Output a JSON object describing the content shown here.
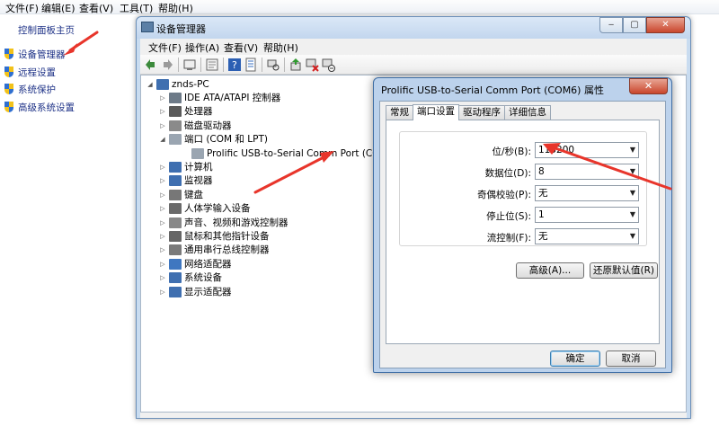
{
  "background_window": {
    "menu": [
      "文件(F)",
      "编辑(E)",
      "查看(V)",
      "工具(T)",
      "帮助(H)"
    ],
    "left_pane": {
      "home_link": "控制面板主页",
      "links": [
        "设备管理器",
        "远程设置",
        "系统保护",
        "高级系统设置"
      ]
    }
  },
  "device_manager": {
    "title": "设备管理器",
    "menu": [
      "文件(F)",
      "操作(A)",
      "查看(V)",
      "帮助(H)"
    ],
    "caption_buttons": {
      "minimize": "‒",
      "maximize": "▢",
      "close": "✕"
    },
    "toolbar_icons": [
      "back-arrow-icon",
      "forward-arrow-icon",
      "computer-icon",
      "properties-icon",
      "help-icon",
      "properties-sheet-icon",
      "scan-hardware-icon",
      "update-driver-icon",
      "uninstall-icon",
      "disable-icon"
    ],
    "tree": {
      "root": "znds-PC",
      "items": [
        {
          "label": "IDE ATA/ATAPI 控制器",
          "expander": "▷",
          "icon_color": "#6d7a88"
        },
        {
          "label": "处理器",
          "expander": "▷",
          "icon_color": "#5a5a5a"
        },
        {
          "label": "磁盘驱动器",
          "expander": "▷",
          "icon_color": "#8a8a8a"
        },
        {
          "label": "端口 (COM 和 LPT)",
          "expander": "◢",
          "icon_color": "#9aa5b1"
        },
        {
          "label": "Prolific USB-to-Serial Comm Port (COM6)",
          "expander": "",
          "icon_color": "#9aa5b1",
          "child": true
        },
        {
          "label": "计算机",
          "expander": "▷",
          "icon_color": "#3f6fb0"
        },
        {
          "label": "监视器",
          "expander": "▷",
          "icon_color": "#3f6fb0"
        },
        {
          "label": "键盘",
          "expander": "▷",
          "icon_color": "#777777"
        },
        {
          "label": "人体学输入设备",
          "expander": "▷",
          "icon_color": "#6a6a6a"
        },
        {
          "label": "声音、视频和游戏控制器",
          "expander": "▷",
          "icon_color": "#888888"
        },
        {
          "label": "鼠标和其他指针设备",
          "expander": "▷",
          "icon_color": "#666666"
        },
        {
          "label": "通用串行总线控制器",
          "expander": "▷",
          "icon_color": "#7a7a7a"
        },
        {
          "label": "网络适配器",
          "expander": "▷",
          "icon_color": "#3f77c0"
        },
        {
          "label": "系统设备",
          "expander": "▷",
          "icon_color": "#3f6fb0"
        },
        {
          "label": "显示适配器",
          "expander": "▷",
          "icon_color": "#3f6fb0"
        }
      ]
    }
  },
  "properties_dialog": {
    "title": "Prolific USB-to-Serial Comm Port (COM6) 属性",
    "close": "✕",
    "tabs": [
      "常规",
      "端口设置",
      "驱动程序",
      "详细信息"
    ],
    "active_tab": 1,
    "settings": [
      {
        "label": "位/秒(B):",
        "value": "115200"
      },
      {
        "label": "数据位(D):",
        "value": "8"
      },
      {
        "label": "奇偶校验(P):",
        "value": "无"
      },
      {
        "label": "停止位(S):",
        "value": "1"
      },
      {
        "label": "流控制(F):",
        "value": "无"
      }
    ],
    "advanced_button": "高级(A)...",
    "restore_button": "还原默认值(R)",
    "ok_button": "确定",
    "cancel_button": "取消"
  },
  "colors": {
    "annotation_arrow": "#e8352b",
    "window_frame": "#c9dcf0",
    "link_text": "#1e3287"
  }
}
